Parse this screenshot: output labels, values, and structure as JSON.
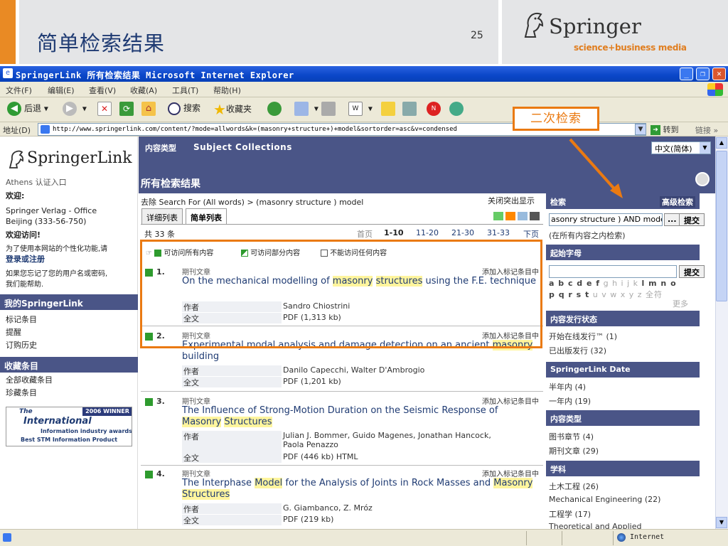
{
  "slide": {
    "title": "简单检索结果",
    "number": "25",
    "brand": "Springer",
    "tagline": "science+business media"
  },
  "window": {
    "title": "SpringerLink  所有检索结果  Microsoft Internet Explorer",
    "minimize": "_",
    "restore": "❐",
    "close": "✕"
  },
  "menu": [
    "文件(F)",
    "编辑(E)",
    "查看(V)",
    "收藏(A)",
    "工具(T)",
    "帮助(H)"
  ],
  "toolbar": {
    "back": "后退",
    "search": "搜索",
    "favorites": "收藏夹"
  },
  "address": {
    "label": "地址(D)",
    "url": "http://www.springerlink.com/content/?mode=allwords&k=(masonry+structure+)+model&sortorder=asc&v=condensed",
    "go": "转到",
    "links": "链接"
  },
  "sidebar": {
    "logo": "SpringerLink",
    "athens": "Athens 认证入口",
    "welcome": "欢迎:",
    "org_line1": "Springer Verlag - Office",
    "org_line2": "Beijing (333-56-750)",
    "welcome_visit": "欢迎访问!",
    "personalize_line1": "为了使用本网站的个性化功能,请",
    "personalize_line2": "登录或注册",
    "forgot_line1": "如果您忘记了您的用户名或密码,",
    "forgot_line2": "我们能帮助.",
    "my_header": "我的SpringerLink",
    "my_items": [
      "标记条目",
      "提醒",
      "订购历史"
    ],
    "fav_header": "收藏条目",
    "fav_items": [
      "全部收藏条目",
      "珍藏条目"
    ],
    "award_the": "The",
    "award_winner": "2006 WINNER",
    "award_intl": "International",
    "award_line2": "Information industry awards",
    "award_line3": "Best STM Information Product"
  },
  "banner": {
    "types_label": "内容类型",
    "subject_collections": "Subject Collections",
    "language": "中文(简体)",
    "results_title": "所有检索结果"
  },
  "main": {
    "breadcrumb": "去除 Search For (All words) > (masonry structure ) model",
    "close_highlight": "关闭突出显示",
    "tab_detail": "详细列表",
    "tab_simple": "简单列表",
    "total": "共 33 条",
    "pager": {
      "first": "首页",
      "p1": "1-10",
      "p2": "11-20",
      "p3": "21-30",
      "p4": "31-33",
      "next": "下页"
    },
    "filter_all": "可访问所有内容",
    "filter_part": "可访问部分内容",
    "filter_none": "不能访问任何内容",
    "author_label": "作者",
    "fulltext_label": "全文",
    "results": [
      {
        "num": "1.",
        "type": "期刊文章",
        "add": "添加入标记条目中",
        "t1": "On the mechanical modelling of ",
        "h1": "masonry",
        "t2": " ",
        "h2": "structures",
        "t3": " using the F.E. technique",
        "author": "Sandro Chiostrini",
        "fulltext": "PDF (1,313 kb)"
      },
      {
        "num": "2.",
        "type": "期刊文章",
        "add": "添加入标记条目中",
        "t1": "Experimental modal analysis and damage detection on an ancient ",
        "h1": "masonry",
        "t2": " building",
        "author": "Danilo Capecchi, Walter D'Ambrogio",
        "fulltext": "PDF (1,201 kb)"
      },
      {
        "num": "3.",
        "type": "期刊文章",
        "add": "添加入标记条目中",
        "t1": "The Influence of Strong-Motion Duration on the Seismic Response of ",
        "h1": "Masonry",
        "t2": " ",
        "h2": "Structures",
        "author_line1": "Julian J. Bommer, Guido Magenes, Jonathan Hancock,",
        "author_line2": "Paola Penazzo",
        "fulltext": "PDF (446 kb)  HTML"
      },
      {
        "num": "4.",
        "type": "期刊文章",
        "add": "添加入标记条目中",
        "t1": "The Interphase ",
        "h1": "Model",
        "t2": " for the Analysis of Joints in Rock Masses and ",
        "h2": "Masonry",
        "t3": " ",
        "h3": "Structures",
        "author": "G. Giambanco, Z. Mróz",
        "fulltext": "PDF (219 kb)"
      }
    ]
  },
  "right": {
    "search_header": "检索",
    "advanced": "高级检索",
    "search_value": "asonry structure ) AND model",
    "more_btn": "...",
    "submit": "提交",
    "within": "(在所有内容之内检索)",
    "start_header": "起始字母",
    "letters_bold": "a b c d e f",
    "letters_light": "g h i j k",
    "letters_bold2": "l m n o",
    "letters_bold3": "p q r s t",
    "letters_light2": "u v w x y z 全符",
    "more": "更多",
    "status_header": "内容发行状态",
    "status_items": [
      "开始在线发行™ (1)",
      "已出版发行 (32)"
    ],
    "date_header": "SpringerLink Date",
    "date_items": [
      "半年内 (4)",
      "一年内 (19)"
    ],
    "ctype_header": "内容类型",
    "ctype_items": [
      "图书章节 (4)",
      "期刊文章 (29)"
    ],
    "subject_header": "学科",
    "subject_items": [
      "土木工程 (26)",
      "Mechanical Engineering (22)",
      "工程学 (17)",
      "Theoretical and Applied"
    ]
  },
  "annotation": {
    "label": "二次检索"
  },
  "status": {
    "zone": "Internet"
  },
  "colors": {
    "accent": "#e98a24",
    "nav": "#4a5587",
    "highlight": "#fff59d",
    "annotation": "#ea7a12"
  }
}
